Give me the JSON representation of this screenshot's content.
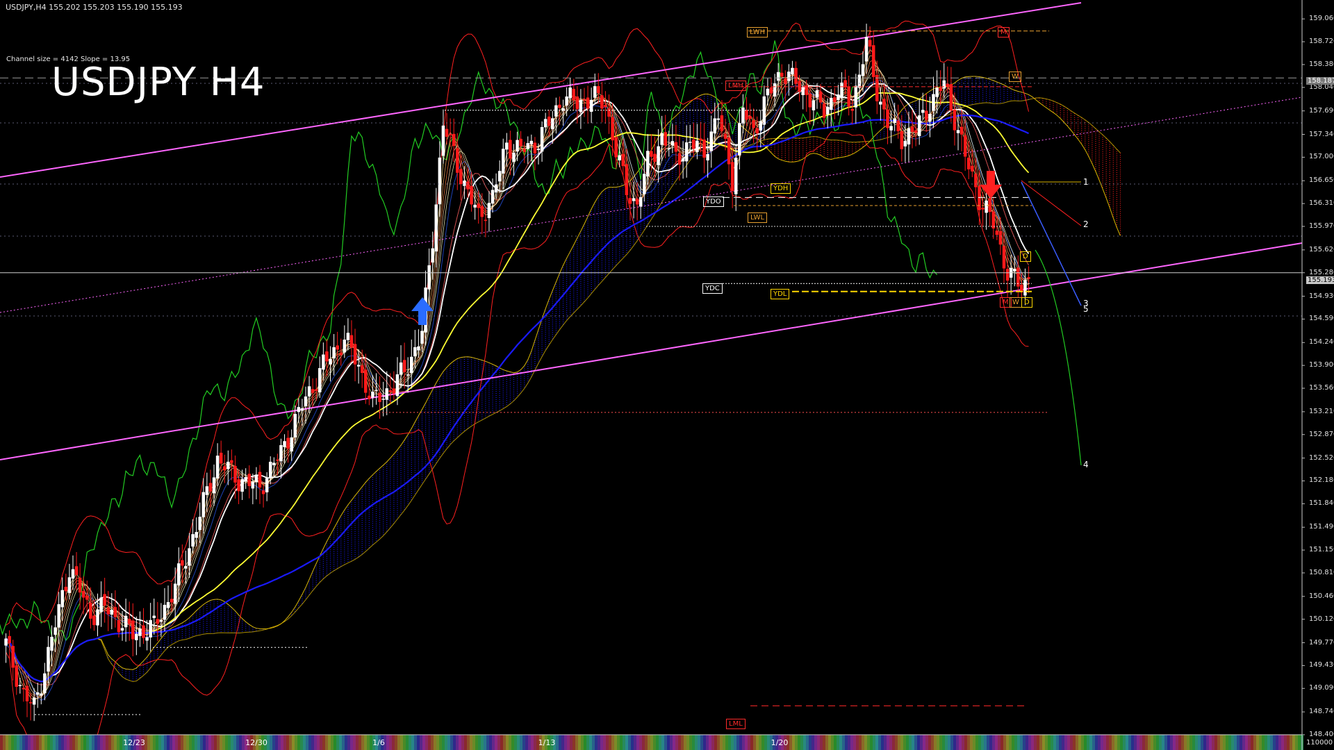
{
  "window": {
    "symbol_info": "USDJPY,H4 155.202 155.203 155.190 155.193",
    "channel_info": "Channel size = 4142 Slope = 13.95",
    "title": "USDJPY H4"
  },
  "axis": {
    "price_labels": [
      "159.060",
      "158.720",
      "158.380",
      "158.040",
      "157.690",
      "157.340",
      "157.000",
      "156.650",
      "156.310",
      "155.970",
      "155.620",
      "155.280",
      "154.930",
      "154.590",
      "154.240",
      "153.900",
      "153.560",
      "153.210",
      "152.870",
      "152.520",
      "152.180",
      "151.840",
      "151.490",
      "151.150",
      "150.810",
      "150.460",
      "150.120",
      "149.770",
      "149.430",
      "149.090",
      "148.740",
      "148.400"
    ],
    "current_price": "155.193",
    "marker_price": "158.187",
    "volume_label": "110000",
    "date_labels": [
      "12/23",
      "12/30",
      "1/6",
      "1/13",
      "1/20"
    ]
  },
  "levels": {
    "lwh": "LWH",
    "m_top": "M",
    "w_top": "W",
    "lmh": "LMH",
    "ydh": "YDH",
    "ydo": "YDO",
    "lwl": "LWL",
    "ydc": "YDC",
    "ydl": "YDL",
    "lml": "LML",
    "d_box": "D",
    "m_box": "M",
    "w_box": "W",
    "d_box2": "D",
    "n1": "1",
    "n2": "2",
    "n3": "3",
    "n4": "4",
    "n5": "5"
  },
  "colors": {
    "bg": "#000000",
    "bull": "#ffffff",
    "bear": "#ff1a1a",
    "ma_white": "#ffffff",
    "ma_yellow": "#ffff33",
    "ma_blue": "#1a1aff",
    "channel": "#ff66ff",
    "bollinger": "#ff2020",
    "green_line": "#22cc22",
    "cloud_blue": "#1a1aff",
    "cloud_red": "#ff2020",
    "ichimoku_yellow": "#ffd700"
  },
  "chart_data": {
    "type": "candlestick",
    "symbol": "USDJPY",
    "timeframe": "H4",
    "ylim": [
      148.4,
      159.4
    ],
    "anchors": [
      [
        0,
        149.75
      ],
      [
        5,
        149.0
      ],
      [
        8,
        148.8
      ],
      [
        12,
        149.6
      ],
      [
        18,
        150.9
      ],
      [
        24,
        150.2
      ],
      [
        28,
        150.3
      ],
      [
        36,
        149.9
      ],
      [
        42,
        150.0
      ],
      [
        48,
        150.6
      ],
      [
        54,
        151.5
      ],
      [
        60,
        152.5
      ],
      [
        66,
        152.2
      ],
      [
        72,
        152.1
      ],
      [
        78,
        152.6
      ],
      [
        84,
        153.3
      ],
      [
        90,
        153.9
      ],
      [
        96,
        154.3
      ],
      [
        100,
        153.9
      ],
      [
        104,
        153.35
      ],
      [
        110,
        153.6
      ],
      [
        114,
        153.9
      ],
      [
        118,
        154.4
      ],
      [
        121,
        155.8
      ],
      [
        124,
        157.5
      ],
      [
        126,
        157.2
      ],
      [
        130,
        156.6
      ],
      [
        134,
        156.1
      ],
      [
        138,
        156.4
      ],
      [
        142,
        157.2
      ],
      [
        146,
        157.1
      ],
      [
        150,
        157.2
      ],
      [
        154,
        157.5
      ],
      [
        158,
        157.9
      ],
      [
        162,
        157.8
      ],
      [
        166,
        157.9
      ],
      [
        170,
        157.8
      ],
      [
        173,
        157.1
      ],
      [
        176,
        156.5
      ],
      [
        179,
        156.3
      ],
      [
        182,
        156.9
      ],
      [
        186,
        157.3
      ],
      [
        190,
        157.0
      ],
      [
        194,
        157.2
      ],
      [
        198,
        157.1
      ],
      [
        202,
        157.6
      ],
      [
        206,
        156.7
      ],
      [
        209,
        157.7
      ],
      [
        212,
        157.4
      ],
      [
        216,
        157.9
      ],
      [
        220,
        158.3
      ],
      [
        224,
        158.1
      ],
      [
        228,
        157.9
      ],
      [
        232,
        157.7
      ],
      [
        236,
        158.0
      ],
      [
        240,
        157.8
      ],
      [
        244,
        158.7
      ],
      [
        247,
        158.0
      ],
      [
        250,
        157.5
      ],
      [
        254,
        157.3
      ],
      [
        258,
        157.4
      ],
      [
        262,
        157.8
      ],
      [
        266,
        158.1
      ],
      [
        269,
        157.6
      ],
      [
        272,
        157.0
      ],
      [
        276,
        156.4
      ],
      [
        280,
        156.0
      ],
      [
        284,
        155.3
      ],
      [
        288,
        155.05
      ],
      [
        290,
        155.19
      ]
    ]
  }
}
